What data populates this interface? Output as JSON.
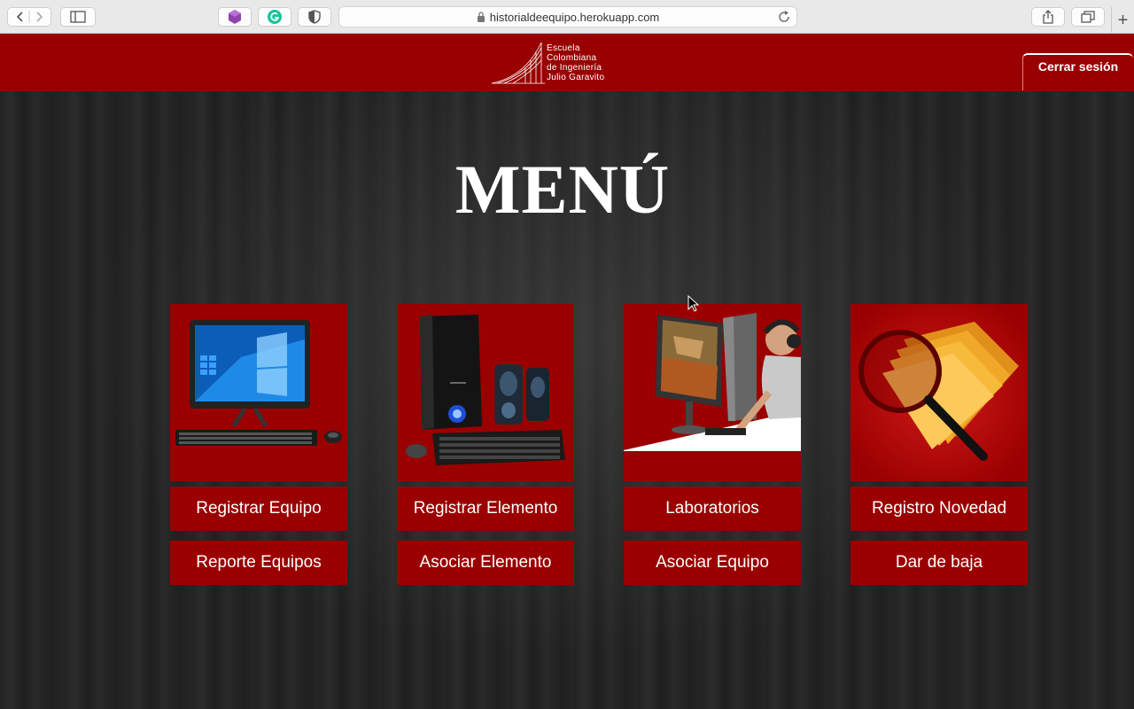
{
  "browser": {
    "url": "historialdeequipo.herokuapp.com"
  },
  "header": {
    "logo_lines": [
      "Escuela",
      "Colombiana",
      "de Ingeniería",
      "Julio Garavito"
    ],
    "logout_label": "Cerrar sesión"
  },
  "main": {
    "title": "MENÚ",
    "cards": [
      {
        "image": "all-in-one-computer",
        "top_button": "Registrar Equipo",
        "bottom_button": "Reporte Equipos"
      },
      {
        "image": "desktop-tower-speakers",
        "top_button": "Registrar Elemento",
        "bottom_button": "Asociar Elemento"
      },
      {
        "image": "gamer-at-computer",
        "top_button": "Laboratorios",
        "bottom_button": "Asociar Equipo"
      },
      {
        "image": "folders-magnifier",
        "top_button": "Registro Novedad",
        "bottom_button": "Dar de baja"
      }
    ]
  },
  "colors": {
    "brand_red": "#990000",
    "background": "#1c1c1c",
    "text": "#ffffff"
  }
}
